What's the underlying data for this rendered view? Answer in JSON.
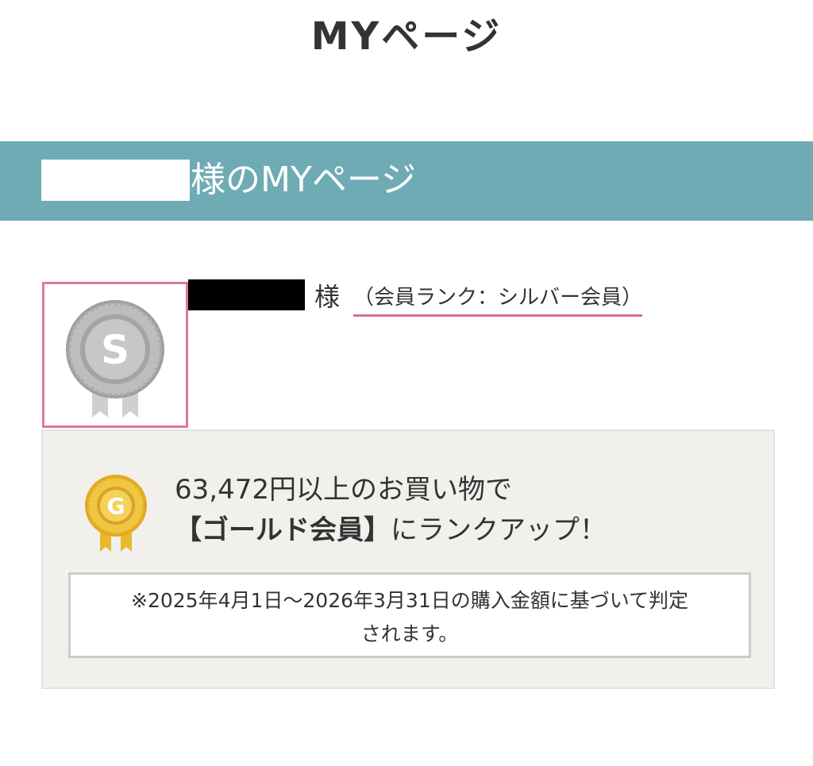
{
  "header": {
    "title": "MYページ"
  },
  "banner": {
    "title": "様のMYページ"
  },
  "member": {
    "honorific": "様",
    "rank_label": "（会員ランク：シルバー会員）",
    "rank_icon_letter": "S",
    "rank_icon": "silver-medal-icon"
  },
  "promo": {
    "line1": "63,472円以上のお買い物で",
    "line2_strong": "【ゴールド会員】",
    "line2_rest": "にランクアップ！",
    "icon_letter": "G",
    "icon": "gold-medal-icon"
  },
  "note": {
    "line1": "※2025年4月1日〜2026年3月31日の購入金額に基づいて判定",
    "line2": "されます。"
  },
  "colors": {
    "banner": "#6eabb4",
    "accent_pink": "#e07a91",
    "panel_bg": "#f2f0ec",
    "silver": "#b5b5b5",
    "gold": "#e8b92c"
  }
}
